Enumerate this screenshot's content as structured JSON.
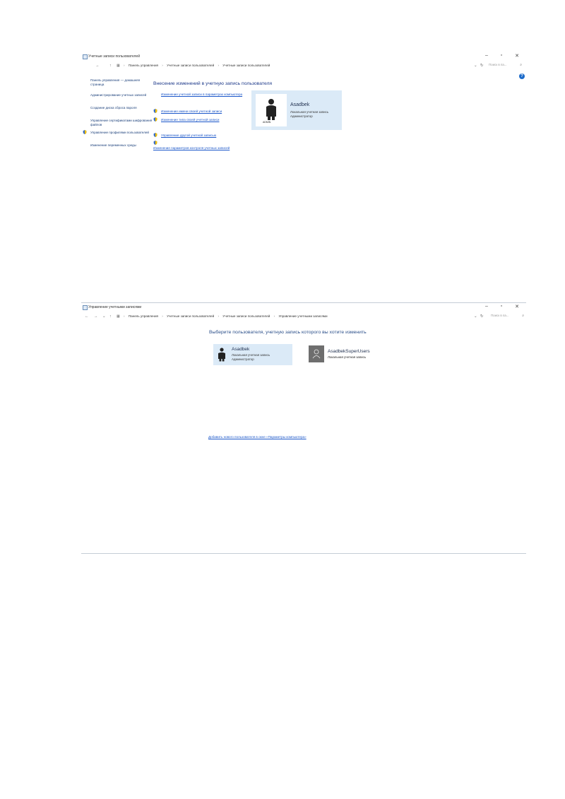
{
  "window1": {
    "title": "Учетные записи пользователей",
    "breadcrumbs": [
      "Панель управления",
      "Учетные записи пользователей",
      "Учетные записи пользователей"
    ],
    "search_placeholder": "Поиск в па...",
    "sidebar": [
      "Панель управления — домашняя страница",
      "Администрирование учетных записей",
      "Создание диска сброса пароля",
      "Управление сертификатами шифрования файлов",
      "Управление профилями пользователей",
      "Изменение переменных среды"
    ],
    "heading": "Внесение изменений в учетную запись пользователя",
    "tasks": [
      "Изменение учетной записи в параметрах компьютера",
      "Изменение имени своей учетной записи",
      "Изменение типа своей учетной записи",
      "Управление другой учетной записью",
      "Изменение параметров контроля учетных записей"
    ],
    "user": {
      "name": "Asadbek",
      "type": "Локальная учетная запись",
      "role": "Администратор",
      "badge": "ADMIN"
    }
  },
  "window2": {
    "title": "Управление учетными записями",
    "breadcrumbs": [
      "Панель управления",
      "Учетные записи пользователей",
      "Учетные записи пользователей",
      "Управление учетными записями"
    ],
    "search_placeholder": "Поиск в па...",
    "heading": "Выберите пользователя, учетную запись которого вы хотите изменить",
    "accounts": [
      {
        "name": "Asadbek",
        "type": "Локальная учетная запись",
        "role": "Администратор"
      },
      {
        "name": "AsadbekSuperUsers",
        "type": "Локальная учетная запись",
        "role": ""
      }
    ],
    "add_user_link": "Добавить нового пользователя в окне «Параметры компьютера»"
  },
  "colors": {
    "accent": "#1a56c9",
    "card": "#dbeaf7",
    "heading": "#1e3a8a"
  }
}
